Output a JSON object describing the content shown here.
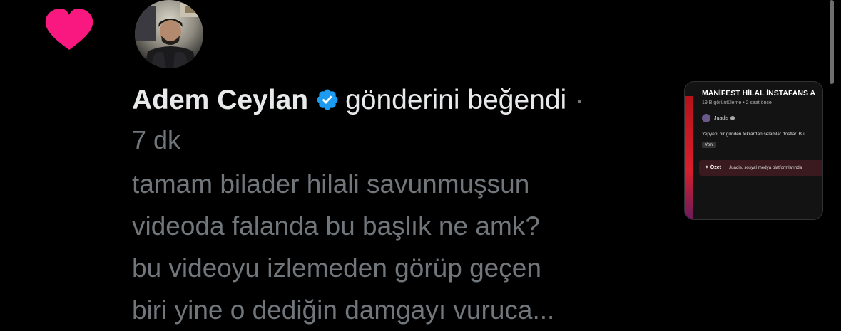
{
  "notification": {
    "user_name": "Adem Ceylan",
    "action_text": "gönderini beğendi",
    "separator": "·",
    "time": "7 dk",
    "tweet_lines": [
      "tamam bilader hilali savunmuşsun",
      "videoda falanda bu başlık ne amk?",
      "bu videoyu izlemeden görüp geçen",
      "biri yine o dediğin damgayı vuruca..."
    ],
    "icons": {
      "like": "heart-icon",
      "verified": "verified-badge-icon"
    },
    "colors": {
      "heart": "#f91880",
      "verified": "#1d9bf0",
      "muted_text": "#71767b",
      "primary_text": "#e7e9ea",
      "background": "#000000"
    }
  },
  "thumbnail": {
    "title": "MANİFEST HİLAL İNSTAFANS A",
    "meta": "19 B görüntüleme • 2 saat önce",
    "channel": "Juadis",
    "description": "Yepyeni bir günden tekrardan selamlar dostlar. Bu",
    "badge": "Yeni",
    "summary_label": "✦ Özet",
    "summary_text": "Juadis, sosyal medya platformlarında"
  }
}
